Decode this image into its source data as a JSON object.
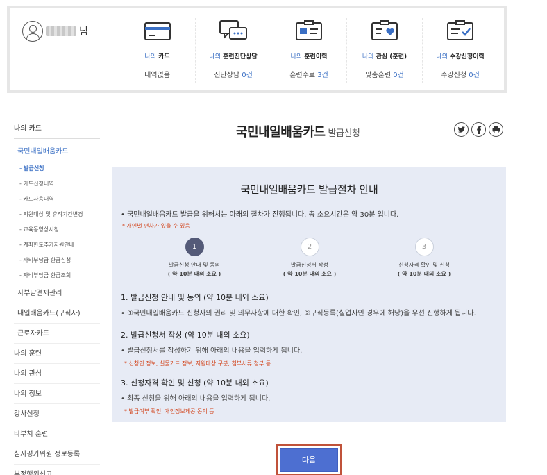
{
  "user": {
    "suffix": "님"
  },
  "stats": [
    {
      "prefix": "나의",
      "label": "카드",
      "value": "내역없음",
      "count": ""
    },
    {
      "prefix": "나의",
      "label": "훈련진단상담",
      "value": "진단상담",
      "count": "0건"
    },
    {
      "prefix": "나의",
      "label": "훈련이력",
      "value": "훈련수료",
      "count": "3건"
    },
    {
      "prefix": "나의",
      "label": "관심 (훈련)",
      "value": "맞춤훈련",
      "count": "0건"
    },
    {
      "prefix": "나의",
      "label": "수강신청이력",
      "value": "수강신청",
      "count": "0건"
    }
  ],
  "sidebar": {
    "head": "나의 카드",
    "sub": "국민내일배움카드",
    "items": [
      "- 발급신청",
      "- 카드신청내역",
      "- 카드사용내역",
      "- 지원대상 및 휴직기간변경",
      "- 교육동영상시청",
      "- 계좌한도추가지원안내",
      "- 자비부담금 환급신청",
      "- 자비부담금 환급조회"
    ],
    "links": [
      "자부담결제관리",
      "내일배움카드(구직자)",
      "근로자카드",
      "나의 훈련",
      "나의 관심",
      "나의 정보",
      "강사신청",
      "타부처 훈련",
      "심사평가위원 정보등록",
      "부정행위신고"
    ]
  },
  "page": {
    "title": "국민내일배움카드",
    "title_sub": "발급신청",
    "share": [
      "twitter-icon",
      "facebook-icon",
      "print-icon"
    ]
  },
  "panel": {
    "heading": "국민내일배움카드 발급절차 안내",
    "note1": "• 국민내일배움카드 발급을 위해서는 아래의 절차가 진행됩니다. 총 소요시간은 약 30분 입니다.",
    "note2": "* 개인별 편차가 있을 수 있음",
    "steps": [
      {
        "num": "1",
        "title": "발급신청 안내 및 동의",
        "time": "( 약 10분 내외 소요 )"
      },
      {
        "num": "2",
        "title": "발급신청서 작성",
        "time": "( 약 10분 내외 소요 )"
      },
      {
        "num": "3",
        "title": "신청자격 확인 및 신청",
        "time": "( 약 10분 내외 소요 )"
      }
    ],
    "sections": [
      {
        "heading": "1. 발급신청 안내 및 동의 (약 10분 내외 소요)",
        "desc": "• ①국민내일배움카드 신청자의 권리 및 의무사항에 대한 확인, ②구직등록(실업자인 경우에 해당)을 우선 진행하게 됩니다.",
        "remark": ""
      },
      {
        "heading": "2. 발급신청서 작성 (약 10분 내외 소요)",
        "desc": "• 발급신청서를 작성하기 위해 아래의 내용을 입력하게 됩니다.",
        "remark": "* 신청인 정보, 실물카드 정보, 지원대상 구분, 첨부서류 첨부 등"
      },
      {
        "heading": "3. 신청자격 확인 및 신청 (약 10분 내외 소요)",
        "desc": "• 최종 신청을 위해 아래의 내용을 입력하게 됩니다.",
        "remark": "* 발급여부 확인, 개인정보제공 동의 등"
      }
    ]
  },
  "next_button": "다음",
  "colors": {
    "accent": "#3a6fc4",
    "panel_bg": "#e7ebf5",
    "button": "#4d6fd1",
    "remark": "#d2431a"
  }
}
